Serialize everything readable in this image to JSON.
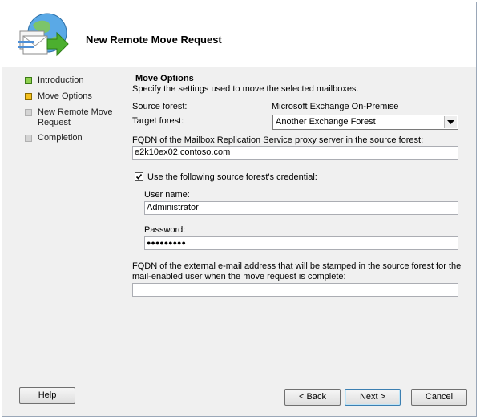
{
  "header": {
    "title": "New Remote Move Request",
    "logo_icon": "exchange-move-wizard-icon"
  },
  "steps": [
    {
      "label": "Introduction",
      "state": "completed",
      "color": "#8fd14f"
    },
    {
      "label": "Move Options",
      "state": "current",
      "color": "#f4c01e"
    },
    {
      "label": "New Remote Move Request",
      "state": "pending",
      "color": "#d4d4d4"
    },
    {
      "label": "Completion",
      "state": "pending",
      "color": "#d4d4d4"
    }
  ],
  "page": {
    "section_title": "Move Options",
    "description": "Specify the settings used to move the selected mailboxes.",
    "source_forest_label": "Source forest:",
    "source_forest_value": "Microsoft Exchange On-Premise",
    "target_forest_label": "Target forest:",
    "target_forest_value": "Another Exchange Forest",
    "fqdn_proxy_label": "FQDN of the Mailbox Replication Service proxy server in the source forest:",
    "fqdn_proxy_value": "e2k10ex02.contoso.com",
    "use_credential_label": "Use the following source forest's credential:",
    "use_credential_checked": true,
    "username_label": "User name:",
    "username_value": "Administrator",
    "password_label": "Password:",
    "password_value": "●●●●●●●●●",
    "external_email_label_line1": "FQDN of the external e-mail address that will be stamped in the source forest for the",
    "external_email_label_line2": "mail-enabled user when the move request is complete:",
    "external_email_value": ""
  },
  "buttons": {
    "help": "Help",
    "back": "< Back",
    "next": "Next >",
    "cancel": "Cancel"
  }
}
